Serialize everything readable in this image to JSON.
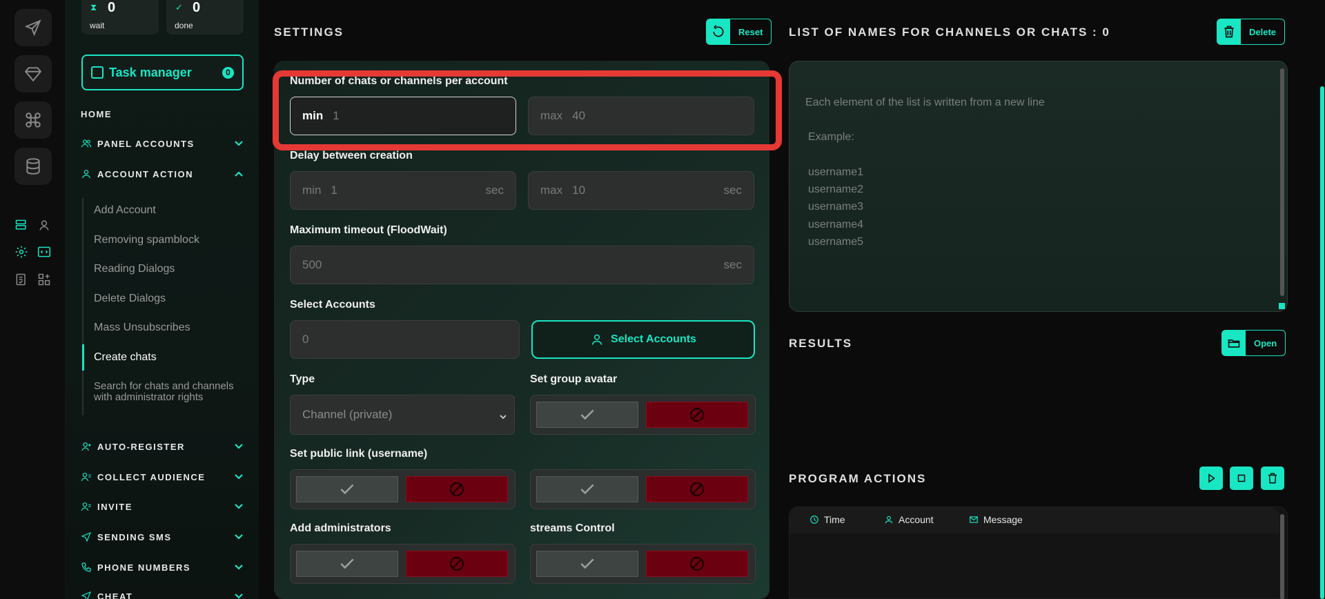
{
  "colors": {
    "accent": "#19e6c3",
    "danger": "#6b0010",
    "highlight": "#e53935"
  },
  "stats": [
    {
      "icon": "hourglass-icon",
      "value": "0",
      "label": "wait"
    },
    {
      "icon": "check-circle-icon",
      "value": "0",
      "label": "done"
    }
  ],
  "task_manager": {
    "label": "Task manager",
    "badge": "0"
  },
  "nav": {
    "home": "HOME",
    "sections": [
      {
        "label": "PANEL ACCOUNTS",
        "icon": "users-icon",
        "expanded": false
      },
      {
        "label": "ACCOUNT ACTION",
        "icon": "user-icon",
        "expanded": true
      },
      {
        "label": "AUTO-REGISTER",
        "icon": "user-plus-icon",
        "expanded": false
      },
      {
        "label": "COLLECT AUDIENCE",
        "icon": "user-list-icon",
        "expanded": false
      },
      {
        "label": "INVITE",
        "icon": "user-list-icon",
        "expanded": false
      },
      {
        "label": "SENDING SMS",
        "icon": "send-icon",
        "expanded": false
      },
      {
        "label": "PHONE NUMBERS",
        "icon": "phone-icon",
        "expanded": false
      },
      {
        "label": "CHEAT",
        "icon": "send-icon",
        "expanded": false
      }
    ],
    "subitems": [
      "Add Account",
      "Removing spamblock",
      "Reading Dialogs",
      "Delete Dialogs",
      "Mass Unsubscribes",
      "Create chats",
      "Search for chats and channels with administrator rights"
    ],
    "active_subitem": "Create chats"
  },
  "settings": {
    "title": "SETTINGS",
    "reset_label": "Reset",
    "count": {
      "label": "Number of chats or channels per account",
      "min_prefix": "min",
      "min_value": "1",
      "max_prefix": "max",
      "max_value": "40"
    },
    "delay": {
      "label": "Delay between creation",
      "min_prefix": "min",
      "min_value": "1",
      "min_unit": "sec",
      "max_prefix": "max",
      "max_value": "10",
      "max_unit": "sec"
    },
    "timeout": {
      "label": "Maximum timeout (FloodWait)",
      "value": "500",
      "unit": "sec"
    },
    "accounts": {
      "label": "Select Accounts",
      "value": "0",
      "button_label": "Select Accounts"
    },
    "type": {
      "label": "Type",
      "selected": "Channel (private)"
    },
    "avatar": {
      "label": "Set group avatar"
    },
    "public_link": {
      "label": "Set public link (username)"
    },
    "admins": {
      "label": "Add administrators"
    },
    "streams": {
      "label": "streams Control"
    }
  },
  "names_list": {
    "title": "LIST OF NAMES FOR CHANNELS OR CHATS : 0",
    "delete_label": "Delete",
    "placeholder_lines": [
      "Each element of the list is written from a new line",
      "Example:",
      "username1",
      "username2",
      "username3",
      "username4",
      "username5"
    ]
  },
  "results": {
    "title": "RESULTS",
    "open_label": "Open"
  },
  "program_actions": {
    "title": "PROGRAM ACTIONS",
    "columns": [
      "Time",
      "Account",
      "Message"
    ]
  }
}
